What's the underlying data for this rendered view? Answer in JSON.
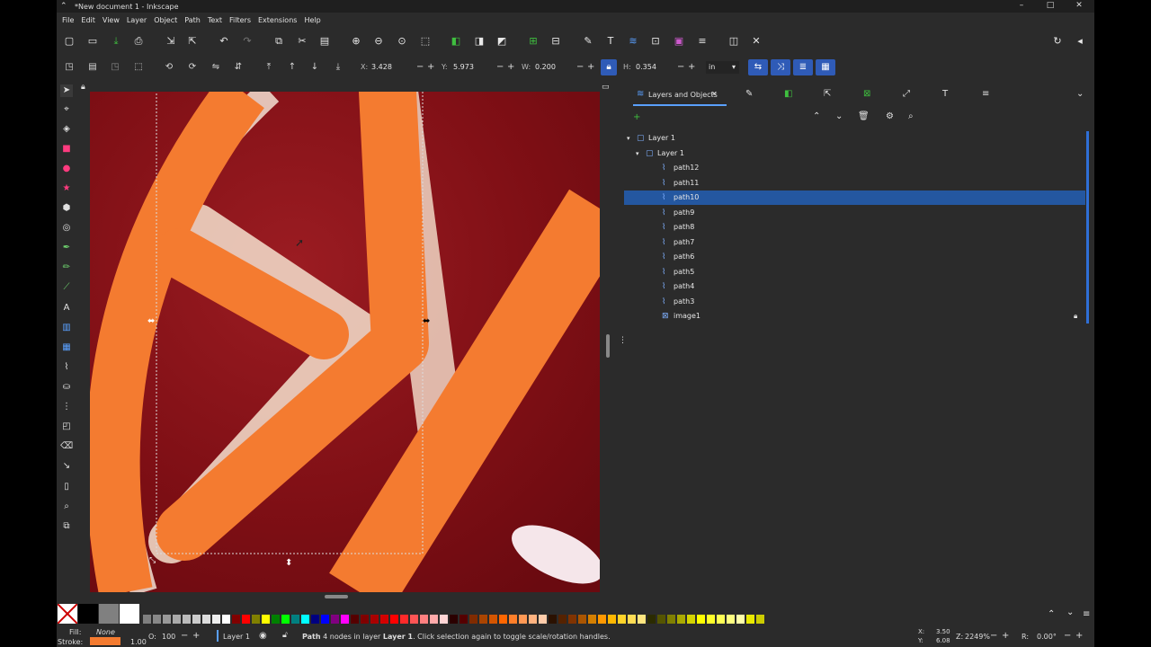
{
  "window": {
    "title": "*New document 1 - Inkscape",
    "controls": [
      "–",
      "□",
      "✕"
    ]
  },
  "menu": [
    "File",
    "Edit",
    "View",
    "Layer",
    "Object",
    "Path",
    "Text",
    "Filters",
    "Extensions",
    "Help"
  ],
  "toolbar": {
    "x_label": "X:",
    "x_value": "3.428",
    "y_label": "Y:",
    "y_value": "5.973",
    "w_label": "W:",
    "w_value": "0.200",
    "h_label": "H:",
    "h_value": "0.354",
    "unit": "in"
  },
  "panel": {
    "tab_label": "Layers and Objects",
    "tree": [
      {
        "label": "Layer 1",
        "type": "layer",
        "depth": 0,
        "expanded": true
      },
      {
        "label": "Layer 1",
        "type": "layer",
        "depth": 1,
        "expanded": true
      },
      {
        "label": "path12",
        "type": "path",
        "depth": 2
      },
      {
        "label": "path11",
        "type": "path",
        "depth": 2
      },
      {
        "label": "path10",
        "type": "path",
        "depth": 2,
        "selected": true
      },
      {
        "label": "path9",
        "type": "path",
        "depth": 2
      },
      {
        "label": "path8",
        "type": "path",
        "depth": 2
      },
      {
        "label": "path7",
        "type": "path",
        "depth": 2
      },
      {
        "label": "path6",
        "type": "path",
        "depth": 2
      },
      {
        "label": "path5",
        "type": "path",
        "depth": 2
      },
      {
        "label": "path4",
        "type": "path",
        "depth": 2
      },
      {
        "label": "path3",
        "type": "path",
        "depth": 2
      },
      {
        "label": "image1",
        "type": "image",
        "depth": 2,
        "locked": true
      }
    ]
  },
  "style_indicator": {
    "fill_label": "Fill:",
    "fill_value": "None",
    "stroke_label": "Stroke:",
    "stroke_color": "#f47b30",
    "stroke_width": "1.00",
    "opacity_label": "O:",
    "opacity_value": "100"
  },
  "status": {
    "layer": "Layer 1",
    "message_prefix": "Path",
    "message_mid": " 4 nodes in layer ",
    "message_layer": "Layer 1",
    "message_suffix": ". Click selection again to toggle scale/rotation handles.",
    "cursor_x_label": "X:",
    "cursor_x": "3.50",
    "cursor_y_label": "Y:",
    "cursor_y": "6.08",
    "zoom_label": "Z:",
    "zoom": "2249%",
    "rotate_label": "R:",
    "rotate": "0.00°"
  },
  "colors": {
    "accent": "#2457a0",
    "orange": "#f47b30",
    "image_bg": "#8b0f16"
  },
  "palette": [
    "#7f7f7f",
    "#888",
    "#999",
    "#aaa",
    "#bbb",
    "#ccc",
    "#ddd",
    "#eee",
    "#fff",
    "#800000",
    "#ff0000",
    "#808000",
    "#ffff00",
    "#008000",
    "#00ff00",
    "#008080",
    "#00ffff",
    "#000080",
    "#0000ff",
    "#800080",
    "#ff00ff",
    "#550000",
    "#800000",
    "#aa0000",
    "#d40000",
    "#ff0000",
    "#ff2a2a",
    "#ff5555",
    "#ff8080",
    "#ffaaaa",
    "#ffd5d5",
    "#2b0000",
    "#550000",
    "#802b00",
    "#aa4400",
    "#d45500",
    "#ff6600",
    "#ff7f2a",
    "#ff9955",
    "#ffb380",
    "#ffccaa",
    "#2b1100",
    "#552200",
    "#803300",
    "#aa5500",
    "#d47f00",
    "#ff9900",
    "#ffb800",
    "#ffd42a",
    "#ffdd55",
    "#ffe680",
    "#2b2b00",
    "#555500",
    "#808000",
    "#aaaa00",
    "#d4d400",
    "#ffff00",
    "#ffff2a",
    "#ffff55",
    "#ffff80",
    "#ffffaa",
    "#e9e900",
    "#cccc00"
  ]
}
